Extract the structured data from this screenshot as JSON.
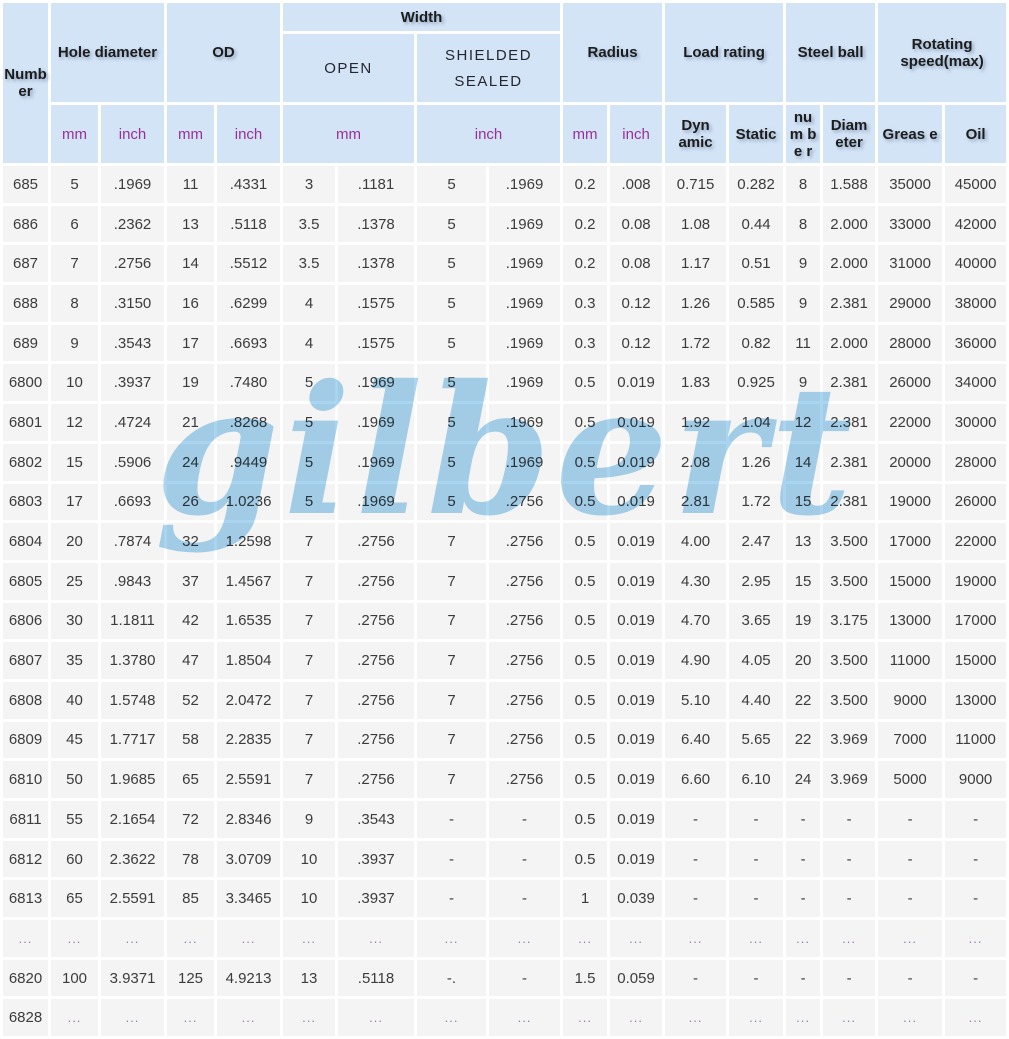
{
  "watermark": "gilbert",
  "colors": {
    "header_bg": "#d3e4f7",
    "row_bg": "#f4f4f4",
    "unit_text": "#9a2f9a",
    "watermark_blue": "#a9d5f0"
  },
  "chart_data": {
    "type": "table",
    "header": {
      "number": "Number",
      "hole_diameter": "Hole diameter",
      "od": "OD",
      "width": "Width",
      "open": "OPEN",
      "shielded": "SHIELDED",
      "sealed": "SEALED",
      "radius": "Radius",
      "load_rating": "Load rating",
      "steel_ball": "Steel ball",
      "rotating_speed": "Rotating speed(max)",
      "unit_mm": "mm",
      "unit_inch": "inch",
      "dynamic": "Dyn amic",
      "static": "Static",
      "ball_number": "nu m be r",
      "ball_diameter": "Diam eter",
      "grease": "Greas e",
      "oil": "Oil"
    },
    "columns": [
      "Number",
      "Hole diameter mm",
      "Hole diameter inch",
      "OD mm",
      "OD inch",
      "Width open mm",
      "Width open inch",
      "Width shielded/sealed mm",
      "Width shielded/sealed inch",
      "Radius mm",
      "Radius inch",
      "Load rating dynamic",
      "Load rating static",
      "Steel ball number",
      "Steel ball diameter",
      "Rotating speed grease",
      "Rotating speed oil"
    ],
    "rows": [
      [
        "685",
        "5",
        ".1969",
        "11",
        ".4331",
        "3",
        ".1181",
        "5",
        ".1969",
        "0.2",
        ".008",
        "0.715",
        "0.282",
        "8",
        "1.588",
        "35000",
        "45000"
      ],
      [
        "686",
        "6",
        ".2362",
        "13",
        ".5118",
        "3.5",
        ".1378",
        "5",
        ".1969",
        "0.2",
        "0.08",
        "1.08",
        "0.44",
        "8",
        "2.000",
        "33000",
        "42000"
      ],
      [
        "687",
        "7",
        ".2756",
        "14",
        ".5512",
        "3.5",
        ".1378",
        "5",
        ".1969",
        "0.2",
        "0.08",
        "1.17",
        "0.51",
        "9",
        "2.000",
        "31000",
        "40000"
      ],
      [
        "688",
        "8",
        ".3150",
        "16",
        ".6299",
        "4",
        ".1575",
        "5",
        ".1969",
        "0.3",
        "0.12",
        "1.26",
        "0.585",
        "9",
        "2.381",
        "29000",
        "38000"
      ],
      [
        "689",
        "9",
        ".3543",
        "17",
        ".6693",
        "4",
        ".1575",
        "5",
        ".1969",
        "0.3",
        "0.12",
        "1.72",
        "0.82",
        "11",
        "2.000",
        "28000",
        "36000"
      ],
      [
        "6800",
        "10",
        ".3937",
        "19",
        ".7480",
        "5",
        ".1969",
        "5",
        ".1969",
        "0.5",
        "0.019",
        "1.83",
        "0.925",
        "9",
        "2.381",
        "26000",
        "34000"
      ],
      [
        "6801",
        "12",
        ".4724",
        "21",
        ".8268",
        "5",
        ".1969",
        "5",
        ".1969",
        "0.5",
        "0.019",
        "1.92",
        "1.04",
        "12",
        "2.381",
        "22000",
        "30000"
      ],
      [
        "6802",
        "15",
        ".5906",
        "24",
        ".9449",
        "5",
        ".1969",
        "5",
        ".1969",
        "0.5",
        "0.019",
        "2.08",
        "1.26",
        "14",
        "2.381",
        "20000",
        "28000"
      ],
      [
        "6803",
        "17",
        ".6693",
        "26",
        "1.0236",
        "5",
        ".1969",
        "5",
        ".2756",
        "0.5",
        "0.019",
        "2.81",
        "1.72",
        "15",
        "2.381",
        "19000",
        "26000"
      ],
      [
        "6804",
        "20",
        ".7874",
        "32",
        "1.2598",
        "7",
        ".2756",
        "7",
        ".2756",
        "0.5",
        "0.019",
        "4.00",
        "2.47",
        "13",
        "3.500",
        "17000",
        "22000"
      ],
      [
        "6805",
        "25",
        ".9843",
        "37",
        "1.4567",
        "7",
        ".2756",
        "7",
        ".2756",
        "0.5",
        "0.019",
        "4.30",
        "2.95",
        "15",
        "3.500",
        "15000",
        "19000"
      ],
      [
        "6806",
        "30",
        "1.1811",
        "42",
        "1.6535",
        "7",
        ".2756",
        "7",
        ".2756",
        "0.5",
        "0.019",
        "4.70",
        "3.65",
        "19",
        "3.175",
        "13000",
        "17000"
      ],
      [
        "6807",
        "35",
        "1.3780",
        "47",
        "1.8504",
        "7",
        ".2756",
        "7",
        ".2756",
        "0.5",
        "0.019",
        "4.90",
        "4.05",
        "20",
        "3.500",
        "11000",
        "15000"
      ],
      [
        "6808",
        "40",
        "1.5748",
        "52",
        "2.0472",
        "7",
        ".2756",
        "7",
        ".2756",
        "0.5",
        "0.019",
        "5.10",
        "4.40",
        "22",
        "3.500",
        "9000",
        "13000"
      ],
      [
        "6809",
        "45",
        "1.7717",
        "58",
        "2.2835",
        "7",
        ".2756",
        "7",
        ".2756",
        "0.5",
        "0.019",
        "6.40",
        "5.65",
        "22",
        "3.969",
        "7000",
        "11000"
      ],
      [
        "6810",
        "50",
        "1.9685",
        "65",
        "2.5591",
        "7",
        ".2756",
        "7",
        ".2756",
        "0.5",
        "0.019",
        "6.60",
        "6.10",
        "24",
        "3.969",
        "5000",
        "9000"
      ],
      [
        "6811",
        "55",
        "2.1654",
        "72",
        "2.8346",
        "9",
        ".3543",
        "-",
        "-",
        "0.5",
        "0.019",
        "-",
        "-",
        "-",
        "-",
        "-",
        "-"
      ],
      [
        "6812",
        "60",
        "2.3622",
        "78",
        "3.0709",
        "10",
        ".3937",
        "-",
        "-",
        "0.5",
        "0.019",
        "-",
        "-",
        "-",
        "-",
        "-",
        "-"
      ],
      [
        "6813",
        "65",
        "2.5591",
        "85",
        "3.3465",
        "10",
        ".3937",
        "-",
        "-",
        "1",
        "0.039",
        "-",
        "-",
        "-",
        "-",
        "-",
        "-"
      ],
      [
        "...",
        "...",
        "...",
        "...",
        "...",
        "...",
        "...",
        "...",
        "...",
        "...",
        "...",
        "...",
        "...",
        "...",
        "...",
        "...",
        "..."
      ],
      [
        "6820",
        "100",
        "3.9371",
        "125",
        "4.9213",
        "13",
        ".5118",
        "-.",
        "-",
        "1.5",
        "0.059",
        "-",
        "-",
        "-",
        "-",
        "-",
        "-"
      ],
      [
        "6828",
        "...",
        "...",
        "...",
        "...",
        "...",
        "...",
        "...",
        "...",
        "...",
        "...",
        "...",
        "...",
        "...",
        "...",
        "...",
        "..."
      ]
    ]
  }
}
